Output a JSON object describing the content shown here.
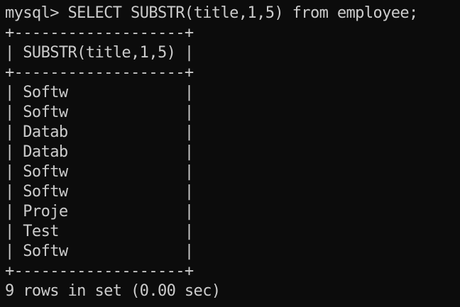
{
  "terminal": {
    "prompt": "mysql> ",
    "command": "SELECT SUBSTR(title,1,5) from employee;"
  },
  "table": {
    "border": "+-------------------+",
    "header": "| SUBSTR(title,1,5) |",
    "rows": [
      "| Softw             |",
      "| Softw             |",
      "| Datab             |",
      "| Datab             |",
      "| Softw             |",
      "| Softw             |",
      "| Proje             |",
      "| Test              |",
      "| Softw             |"
    ]
  },
  "status": "9 rows in set (0.00 sec)",
  "colors": {
    "background": "#0c0c0c",
    "foreground": "#cccccc"
  }
}
